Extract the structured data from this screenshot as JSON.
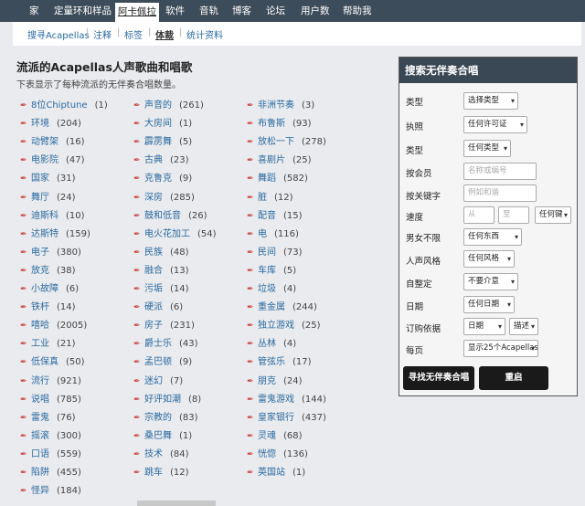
{
  "topnav": [
    "家",
    "定量环和样品",
    "阿卡佩拉",
    "软件",
    "音轨",
    "博客",
    "论坛",
    "用户数",
    "帮助我"
  ],
  "subnav": [
    "搜寻Acapellas",
    "注释",
    "标签",
    "体裁",
    "统计资料"
  ],
  "page": {
    "title": "流派的Acapellas人声歌曲和唱歌",
    "desc": "下表显示了每种流派的无伴奏合唱数量。"
  },
  "genres": [
    [
      {
        "label": "8位Chiptune",
        "count": "(1)"
      },
      {
        "label": "环境",
        "count": "(204)"
      },
      {
        "label": "动臂架",
        "count": "(16)"
      },
      {
        "label": "电影院",
        "count": "(47)"
      },
      {
        "label": "国家",
        "count": "(31)"
      },
      {
        "label": "舞厅",
        "count": "(24)"
      },
      {
        "label": "迪斯科",
        "count": "(10)"
      },
      {
        "label": "达斯特",
        "count": "(159)"
      },
      {
        "label": "电子",
        "count": "(380)"
      },
      {
        "label": "放克",
        "count": "(38)"
      },
      {
        "label": "小故障",
        "count": "(6)"
      },
      {
        "label": "铁杆",
        "count": "(14)"
      },
      {
        "label": "嘻哈",
        "count": "(2005)"
      },
      {
        "label": "工业",
        "count": "(21)"
      },
      {
        "label": "低保真",
        "count": "(50)"
      },
      {
        "label": "流行",
        "count": "(921)"
      },
      {
        "label": "说唱",
        "count": "(785)"
      },
      {
        "label": "雷鬼",
        "count": "(76)"
      },
      {
        "label": "摇滚",
        "count": "(300)"
      },
      {
        "label": "口语",
        "count": "(559)"
      },
      {
        "label": "陷阱",
        "count": "(455)"
      },
      {
        "label": "怪异",
        "count": "(184)"
      }
    ],
    [
      {
        "label": "声音的",
        "count": "(261)"
      },
      {
        "label": "大房间",
        "count": "(1)"
      },
      {
        "label": "霹雳舞",
        "count": "(5)"
      },
      {
        "label": "古典",
        "count": "(23)"
      },
      {
        "label": "克鲁克",
        "count": "(9)"
      },
      {
        "label": "深房",
        "count": "(285)"
      },
      {
        "label": "鼓和低音",
        "count": "(26)"
      },
      {
        "label": "电火花加工",
        "count": "(54)"
      },
      {
        "label": "民族",
        "count": "(48)"
      },
      {
        "label": "融合",
        "count": "(13)"
      },
      {
        "label": "污垢",
        "count": "(14)"
      },
      {
        "label": "硬派",
        "count": "(6)"
      },
      {
        "label": "房子",
        "count": "(231)"
      },
      {
        "label": "爵士乐",
        "count": "(43)"
      },
      {
        "label": "孟巴顿",
        "count": "(9)"
      },
      {
        "label": "迷幻",
        "count": "(7)"
      },
      {
        "label": "好评如潮",
        "count": "(8)"
      },
      {
        "label": "宗教的",
        "count": "(83)"
      },
      {
        "label": "桑巴舞",
        "count": "(1)"
      },
      {
        "label": "技术",
        "count": "(84)"
      },
      {
        "label": "跳车",
        "count": "(12)"
      }
    ],
    [
      {
        "label": "非洲节奏",
        "count": "(3)"
      },
      {
        "label": "布鲁斯",
        "count": "(93)"
      },
      {
        "label": "放松一下",
        "count": "(278)"
      },
      {
        "label": "喜剧片",
        "count": "(25)"
      },
      {
        "label": "舞蹈",
        "count": "(582)"
      },
      {
        "label": "脏",
        "count": "(12)"
      },
      {
        "label": "配音",
        "count": "(15)"
      },
      {
        "label": "电",
        "count": "(116)"
      },
      {
        "label": "民间",
        "count": "(73)"
      },
      {
        "label": "车库",
        "count": "(5)"
      },
      {
        "label": "垃圾",
        "count": "(4)"
      },
      {
        "label": "重金属",
        "count": "(244)"
      },
      {
        "label": "独立游戏",
        "count": "(25)"
      },
      {
        "label": "丛林",
        "count": "(4)"
      },
      {
        "label": "管弦乐",
        "count": "(17)"
      },
      {
        "label": "朋克",
        "count": "(24)"
      },
      {
        "label": "雷鬼游戏",
        "count": "(144)"
      },
      {
        "label": "皇家银行",
        "count": "(437)"
      },
      {
        "label": "灵魂",
        "count": "(68)"
      },
      {
        "label": "恍惚",
        "count": "(136)"
      },
      {
        "label": "英国站",
        "count": "(1)"
      }
    ]
  ],
  "panel": {
    "title": "搜索无伴奏合唱",
    "fields": {
      "type1": {
        "label": "类型",
        "value": "选择类型"
      },
      "license": {
        "label": "执照",
        "value": "任何许可证"
      },
      "type2": {
        "label": "类型",
        "value": "任何类型"
      },
      "member": {
        "label": "按会员",
        "placeholder": "名称或编号"
      },
      "keyword": {
        "label": "按关键字",
        "placeholder": "例如和谐"
      },
      "tempo": {
        "label": "速度",
        "from": "从",
        "to": "至",
        "key": "任何键"
      },
      "gender": {
        "label": "男女不限",
        "value": "任何东西"
      },
      "style": {
        "label": "人声风格",
        "value": "任何风格"
      },
      "autotune": {
        "label": "自整定",
        "value": "不要介意"
      },
      "date": {
        "label": "日期",
        "value": "任何日期"
      },
      "order": {
        "label": "订购依据",
        "value": "日期",
        "dir": "描述"
      },
      "perpage": {
        "label": "每页",
        "value": "显示25个Acapellas"
      }
    },
    "search_button": "寻找无伴奏合唱",
    "reset_button": "重启"
  }
}
